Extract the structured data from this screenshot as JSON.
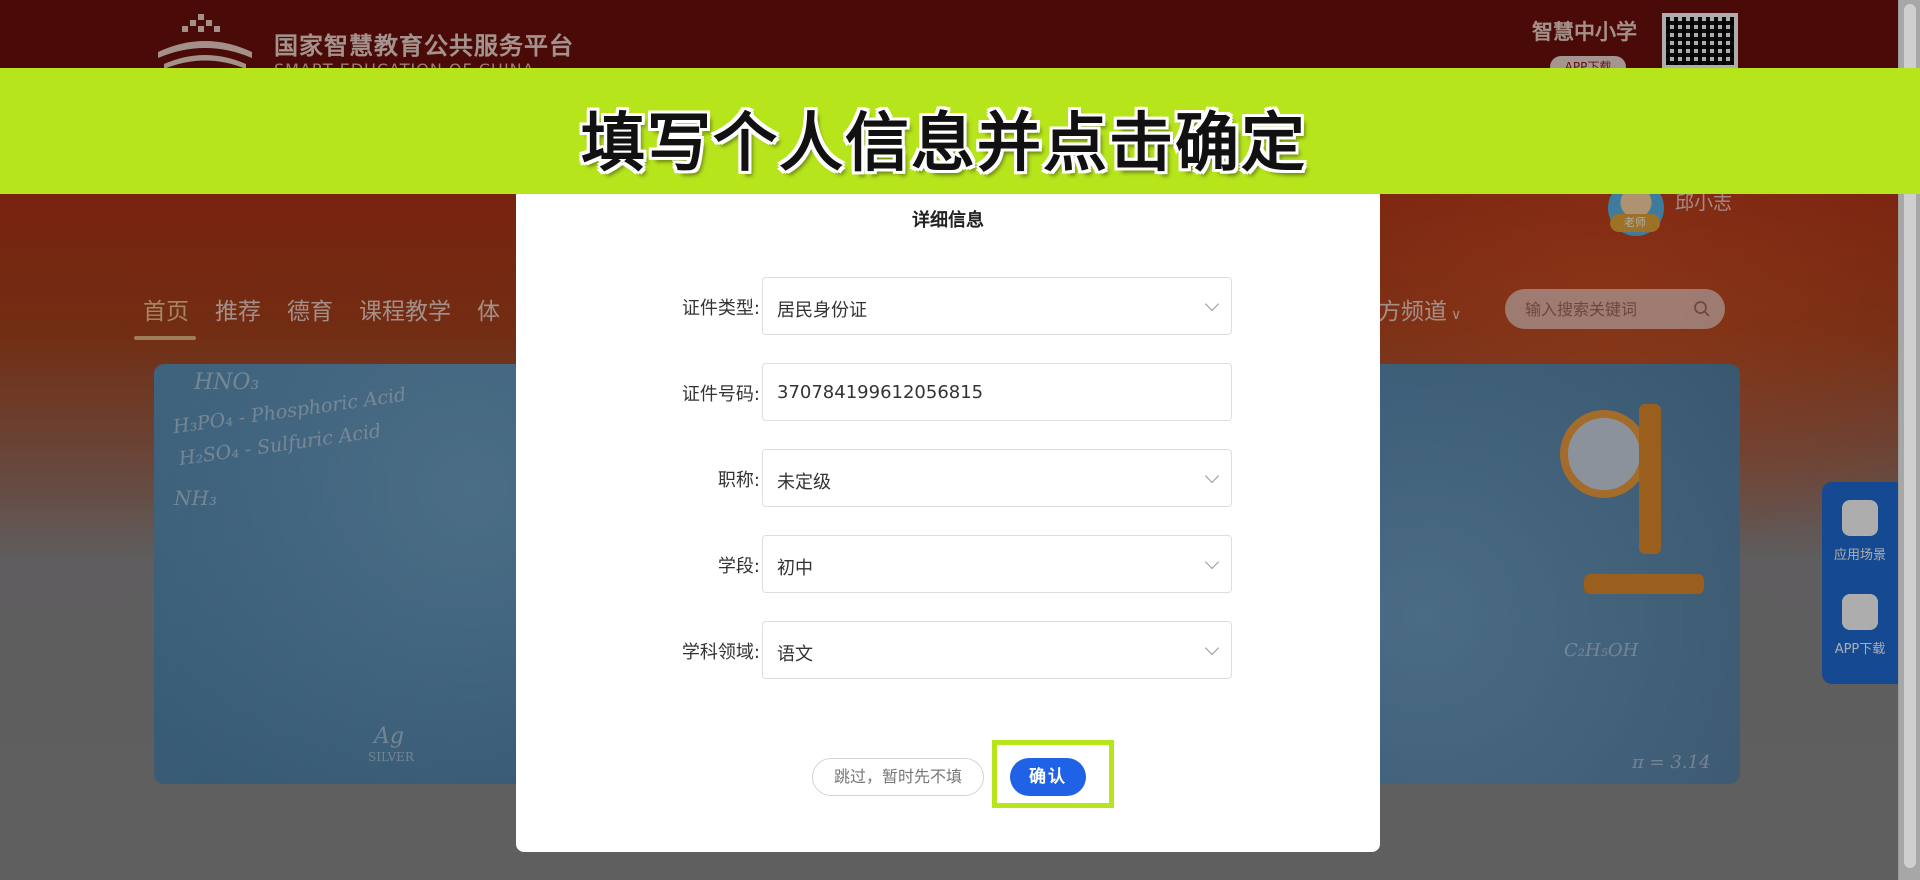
{
  "site": {
    "title": "国家智慧教育公共服务平台",
    "subtitle": "SMART EDUCATION OF CHINA"
  },
  "header": {
    "section_title": "智慧中小学",
    "app_download_pill": "APP下载"
  },
  "user": {
    "name": "邱小志",
    "role_badge": "老师"
  },
  "nav": {
    "items": [
      {
        "label": "首页",
        "active": true
      },
      {
        "label": "推荐"
      },
      {
        "label": "德育"
      },
      {
        "label": "课程教学"
      },
      {
        "label": "体"
      }
    ],
    "right_item": "方频道",
    "right_chevron": "∨"
  },
  "search": {
    "placeholder": "输入搜索关键词"
  },
  "banner": {
    "doodles": [
      "HNO₃",
      "H₃PO₄ - Phosphoric Acid",
      "H₂SO₄ - Sulfuric Acid",
      "NH₃",
      "C₂H₅OH",
      "Ag",
      "SILVER",
      "π = 3.14"
    ]
  },
  "side_panel": {
    "items": [
      {
        "label": "应用场景",
        "icon": "hexagon-app-icon"
      },
      {
        "label": "APP下载",
        "icon": "phone-download-icon"
      }
    ]
  },
  "modal": {
    "title": "详细信息",
    "fields": [
      {
        "label": "证件类型:",
        "value": "居民身份证",
        "type": "select"
      },
      {
        "label": "证件号码:",
        "value": "370784199612056815",
        "type": "input"
      },
      {
        "label": "职称:",
        "value": "未定级",
        "type": "select"
      },
      {
        "label": "学段:",
        "value": "初中",
        "type": "select"
      },
      {
        "label": "学科领域:",
        "value": "语文",
        "type": "select"
      }
    ],
    "skip_label": "跳过，暂时先不填",
    "confirm_label": "确认"
  },
  "instruction": {
    "text": "填写个人信息并点击确定"
  },
  "colors": {
    "accent_green": "#b7e51c",
    "confirm_blue": "#1f62e6",
    "header_red": "#7a120e"
  }
}
